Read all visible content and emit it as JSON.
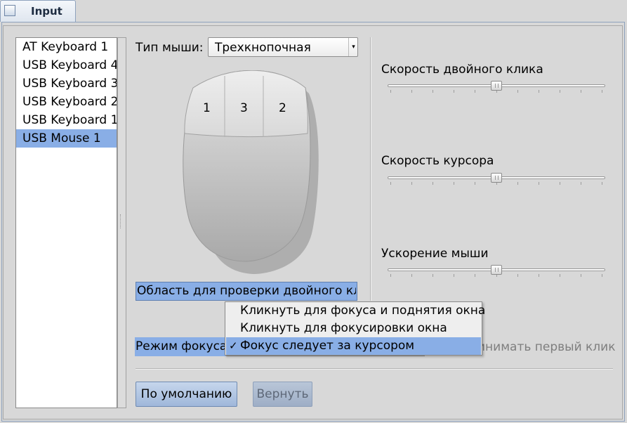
{
  "window": {
    "tab_title": "Input"
  },
  "devices": {
    "items": [
      "AT Keyboard 1",
      "USB Keyboard 4",
      "USB Keyboard 3",
      "USB Keyboard 2",
      "USB Keyboard 1",
      "USB Mouse 1"
    ],
    "selected": "USB Mouse 1"
  },
  "mouse_type": {
    "label": "Тип мыши:",
    "value": "Трехкнопочная"
  },
  "mouse_buttons": [
    "1",
    "3",
    "2"
  ],
  "double_click_area": {
    "label": "Область для проверки двойного клика"
  },
  "focus_mode": {
    "label": "Режим фокуса:",
    "options": [
      "Кликнуть для фокуса и поднятия окна",
      "Кликнуть для фокусировки окна",
      "Фокус следует за курсором"
    ],
    "selected": "Фокус следует за курсором",
    "check_glyph": "✓"
  },
  "first_click": {
    "label": "инимать первый клик"
  },
  "sliders": {
    "double_click_speed": {
      "label": "Скорость двойного клика",
      "value": 0.5
    },
    "cursor_speed": {
      "label": "Скорость курсора",
      "value": 0.5
    },
    "mouse_acceleration": {
      "label": "Ускорение мыши",
      "value": 0.5
    }
  },
  "buttons": {
    "default": "По умолчанию",
    "revert": "Вернуть"
  },
  "colors": {
    "selection": "#89aee6",
    "accent_border": "#8ea2bd"
  }
}
